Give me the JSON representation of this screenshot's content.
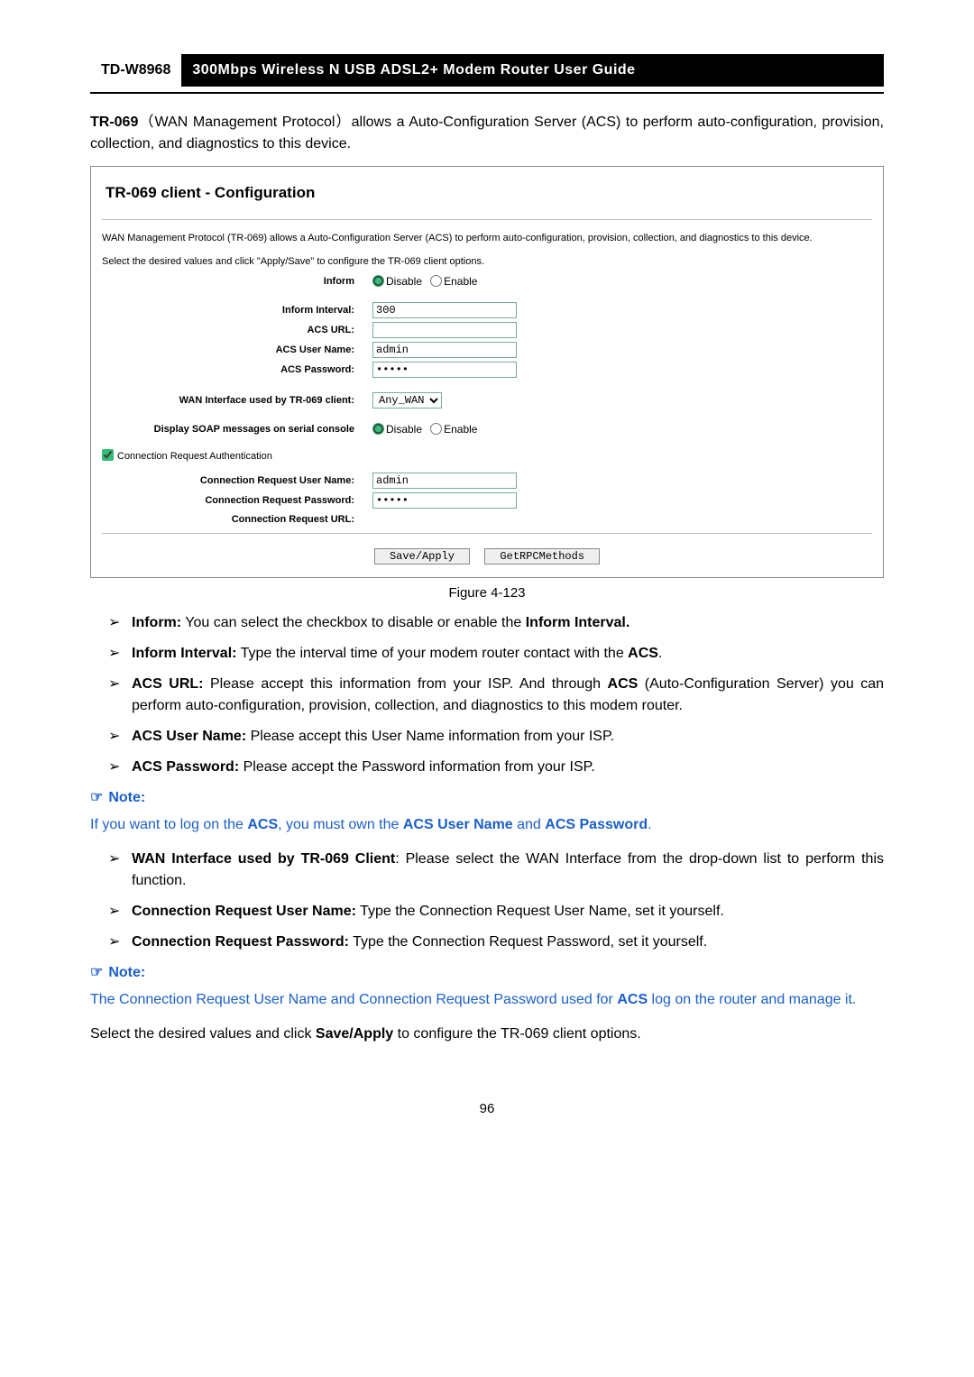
{
  "header": {
    "model": "TD-W8968",
    "title": "300Mbps Wireless N USB ADSL2+ Modem Router User Guide"
  },
  "intro": {
    "term": "TR-069",
    "paren_open": "（",
    "protocol": "WAN Management Protocol",
    "paren_close": "）",
    "rest": "allows a Auto-Configuration Server (ACS) to perform auto-configuration, provision, collection, and diagnostics to this device."
  },
  "figure": {
    "title": "TR-069 client - Configuration",
    "description": "WAN Management Protocol (TR-069) allows a Auto-Configuration Server (ACS) to perform auto-configuration, provision, collection, and diagnostics to this device.",
    "subline": "Select the desired values and click \"Apply/Save\" to configure the TR-069 client options.",
    "labels": {
      "inform": "Inform",
      "inform_interval": "Inform Interval:",
      "acs_url": "ACS URL:",
      "acs_user": "ACS User Name:",
      "acs_pass": "ACS Password:",
      "wan_iface": "WAN Interface used by TR-069 client:",
      "soap": "Display SOAP messages on serial console",
      "conn_auth": "Connection Request Authentication",
      "conn_user": "Connection Request User Name:",
      "conn_pass": "Connection Request Password:",
      "conn_url": "Connection Request URL:"
    },
    "radio": {
      "disable": "Disable",
      "enable": "Enable"
    },
    "values": {
      "inform_interval": "300",
      "acs_url": "",
      "acs_user": "admin",
      "acs_pass": "•••••",
      "wan_iface": "Any_WAN",
      "conn_user": "admin",
      "conn_pass": "•••••",
      "conn_url": ""
    },
    "buttons": {
      "save": "Save/Apply",
      "rpc": "GetRPCMethods"
    },
    "caption": "Figure 4-123"
  },
  "bullets1": [
    {
      "term": "Inform:",
      "text": " You can select the checkbox to disable or enable the ",
      "tail_bold": "Inform Interval."
    },
    {
      "term": "Inform Interval:",
      "text": " Type the interval time of your modem router contact with the ",
      "tail_bold": "ACS",
      "tail_suffix": "."
    },
    {
      "term": "ACS URL:",
      "text": " Please accept this information from your ISP. And through ",
      "tail_bold": "ACS",
      "tail_suffix": " (Auto-Configuration Server) you can perform auto-configuration, provision, collection, and diagnostics to this modem router."
    },
    {
      "term": "ACS User Name:",
      "text": " Please accept this User Name information from your ISP."
    },
    {
      "term": "ACS Password:",
      "text": " Please accept the Password information from your ISP."
    }
  ],
  "note1": {
    "label": "Note:",
    "text_pre": "If you want to log on the ",
    "b1": "ACS",
    "mid1": ", you must own the ",
    "b2": "ACS User Name",
    "mid2": " and ",
    "b3": "ACS Password",
    "tail": "."
  },
  "bullets2": [
    {
      "term": "WAN Interface used by TR-069 Client",
      "text": ": Please select the WAN Interface from the drop-down list to perform this function."
    },
    {
      "term": "Connection Request User Name:",
      "text": " Type the Connection Request User Name, set it yourself."
    },
    {
      "term": "Connection Request Password:",
      "text": " Type the Connection Request Password, set it yourself."
    }
  ],
  "note2": {
    "label": "Note:",
    "text_pre": "The Connection Request User Name and Connection Request Password used for ",
    "b1": "ACS",
    "tail": " log on the router and manage it."
  },
  "closing": {
    "pre": "Select the desired values and click ",
    "bold": "Save/Apply",
    "post": " to configure the TR-069 client options."
  },
  "pagenum": "96"
}
